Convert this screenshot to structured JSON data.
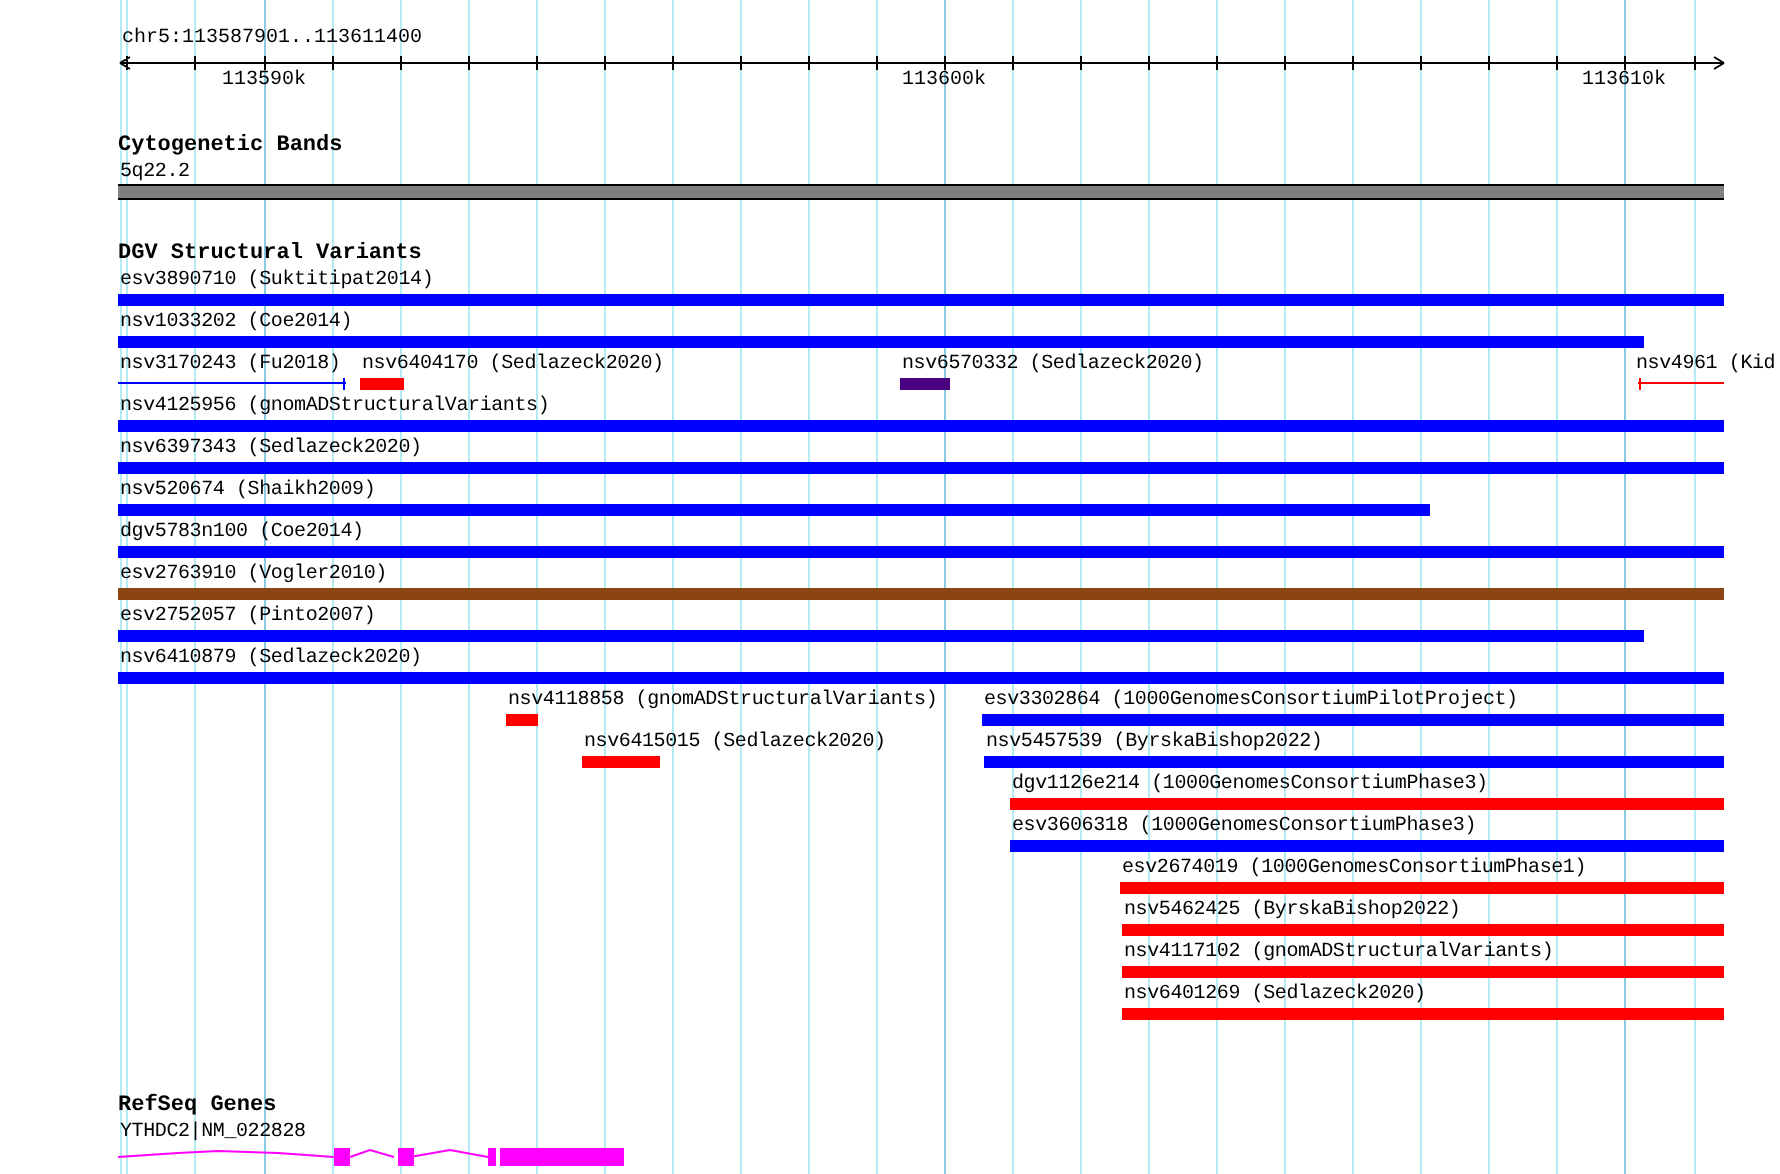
{
  "ruler": {
    "location": "chr5:113587901..113611400",
    "ticks": [
      "113590k",
      "113600k",
      "113610k"
    ]
  },
  "tracks": [
    {
      "title": "Cytogenetic Bands",
      "features": [
        {
          "label": "5q22.2",
          "kind": "band",
          "color": "#808080"
        }
      ]
    },
    {
      "title": "DGV Structural Variants",
      "features": [
        {
          "label": "esv3890710 (Suktitipat2014)",
          "kind": "bar",
          "color": "#0000ff"
        },
        {
          "label": "nsv1033202 (Coe2014)",
          "kind": "bar",
          "color": "#0000ff"
        },
        {
          "label": "nsv3170243 (Fu2018)",
          "kind": "line",
          "color": "#0000ff"
        },
        {
          "label": "nsv6404170 (Sedlazeck2020)",
          "kind": "bar",
          "color": "#ff0000"
        },
        {
          "label": "nsv6570332 (Sedlazeck2020)",
          "kind": "bar",
          "color": "#4b0082"
        },
        {
          "label": "nsv4961 (Kid",
          "kind": "line",
          "color": "#ff0000"
        },
        {
          "label": "nsv4125956 (gnomADStructuralVariants)",
          "kind": "bar",
          "color": "#0000ff"
        },
        {
          "label": "nsv6397343 (Sedlazeck2020)",
          "kind": "bar",
          "color": "#0000ff"
        },
        {
          "label": "nsv520674 (Shaikh2009)",
          "kind": "bar",
          "color": "#0000ff"
        },
        {
          "label": "dgv5783n100 (Coe2014)",
          "kind": "bar",
          "color": "#0000ff"
        },
        {
          "label": "esv2763910 (Vogler2010)",
          "kind": "bar",
          "color": "#8b4513"
        },
        {
          "label": "esv2752057 (Pinto2007)",
          "kind": "bar",
          "color": "#0000ff"
        },
        {
          "label": "nsv6410879 (Sedlazeck2020)",
          "kind": "bar",
          "color": "#0000ff"
        },
        {
          "label": "nsv4118858 (gnomADStructuralVariants)",
          "kind": "bar",
          "color": "#ff0000"
        },
        {
          "label": "esv3302864 (1000GenomesConsortiumPilotProject)",
          "kind": "bar",
          "color": "#0000ff"
        },
        {
          "label": "nsv6415015 (Sedlazeck2020)",
          "kind": "bar",
          "color": "#ff0000"
        },
        {
          "label": "nsv5457539 (ByrskaBishop2022)",
          "kind": "bar",
          "color": "#0000ff"
        },
        {
          "label": "dgv1126e214 (1000GenomesConsortiumPhase3)",
          "kind": "bar",
          "color": "#ff0000"
        },
        {
          "label": "esv3606318 (1000GenomesConsortiumPhase3)",
          "kind": "bar",
          "color": "#0000ff"
        },
        {
          "label": "esv2674019 (1000GenomesConsortiumPhase1)",
          "kind": "bar",
          "color": "#ff0000"
        },
        {
          "label": "nsv5462425 (ByrskaBishop2022)",
          "kind": "bar",
          "color": "#ff0000"
        },
        {
          "label": "nsv4117102 (gnomADStructuralVariants)",
          "kind": "bar",
          "color": "#ff0000"
        },
        {
          "label": "nsv6401269 (Sedlazeck2020)",
          "kind": "bar",
          "color": "#ff0000"
        }
      ]
    },
    {
      "title": "RefSeq Genes",
      "features": [
        {
          "label": "YTHDC2|NM_022828",
          "kind": "gene",
          "color": "#ff00ff"
        }
      ]
    }
  ]
}
